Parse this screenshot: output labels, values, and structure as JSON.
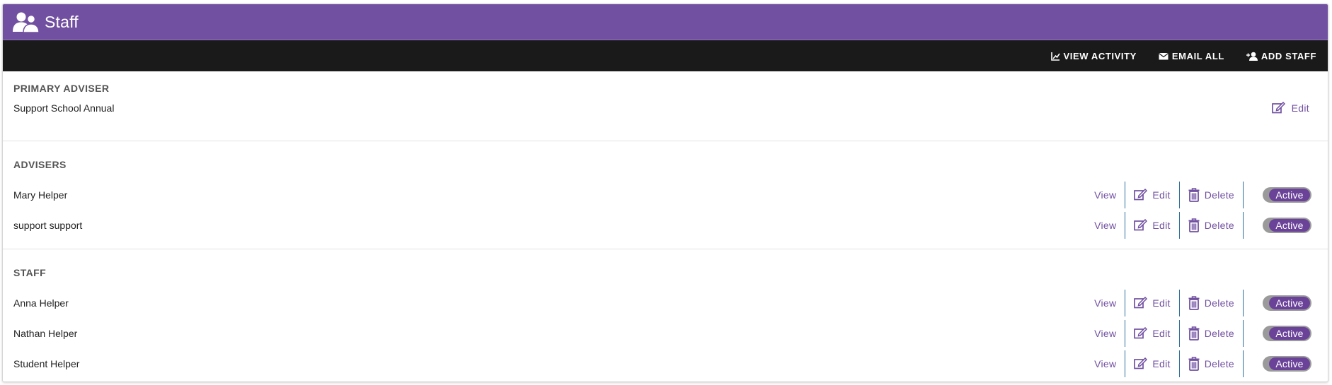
{
  "colors": {
    "header": "#7150a1",
    "toolbar": "#1a1a1a",
    "accent": "#7150a1",
    "toggle_on": "#6a4399",
    "toggle_track": "#9a9a9a",
    "separator": "#2b6f9c"
  },
  "header": {
    "title": "Staff",
    "icon": "users-icon"
  },
  "toolbar": {
    "view_activity": "VIEW ACTIVITY",
    "email_all": "EMAIL ALL",
    "add_staff": "ADD STAFF"
  },
  "sections": {
    "primary": {
      "title": "PRIMARY ADVISER",
      "rows": [
        {
          "name": "Support School Annual",
          "edit": "Edit"
        }
      ]
    },
    "advisers": {
      "title": "ADVISERS",
      "rows": [
        {
          "name": "Mary Helper",
          "view": "View",
          "edit": "Edit",
          "delete": "Delete",
          "status": "Active"
        },
        {
          "name": "support support",
          "view": "View",
          "edit": "Edit",
          "delete": "Delete",
          "status": "Active"
        }
      ]
    },
    "staff": {
      "title": "STAFF",
      "rows": [
        {
          "name": "Anna Helper",
          "view": "View",
          "edit": "Edit",
          "delete": "Delete",
          "status": "Active"
        },
        {
          "name": "Nathan Helper",
          "view": "View",
          "edit": "Edit",
          "delete": "Delete",
          "status": "Active"
        },
        {
          "name": "Student Helper",
          "view": "View",
          "edit": "Edit",
          "delete": "Delete",
          "status": "Active"
        }
      ]
    }
  }
}
